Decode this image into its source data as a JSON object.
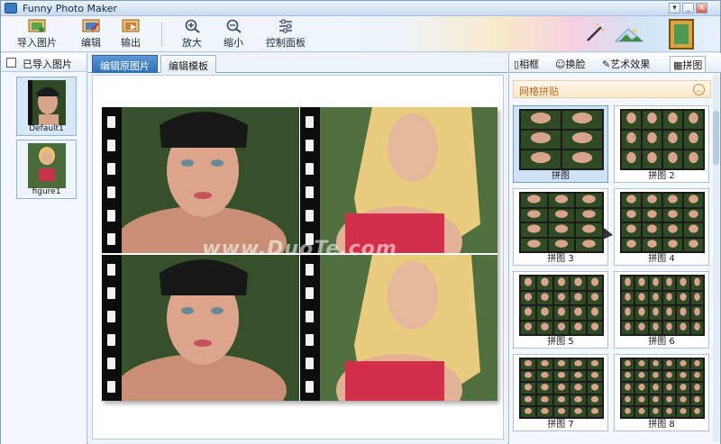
{
  "window": {
    "title": "Funny Photo Maker"
  },
  "toolbar": {
    "import_label": "导入图片",
    "edit_label": "编辑",
    "export_label": "输出",
    "zoom_in_label": "放大",
    "zoom_out_label": "缩小",
    "control_panel_label": "控制面板"
  },
  "left_panel": {
    "title": "已导入图片",
    "items": [
      {
        "label": "Default1",
        "selected": true
      },
      {
        "label": "figure1",
        "selected": false
      }
    ]
  },
  "center": {
    "tabs": [
      {
        "label": "编辑原图片",
        "active": true
      },
      {
        "label": "编辑模板",
        "active": false
      }
    ],
    "watermark": "www.DuoTe.com"
  },
  "right_panel": {
    "tabs": [
      {
        "label": "相框",
        "active": false
      },
      {
        "label": "换脸",
        "active": false
      },
      {
        "label": "艺术效果",
        "active": false
      },
      {
        "label": "拼图",
        "active": true
      }
    ],
    "section_title": "网格拼贴",
    "grid_items": [
      {
        "label": "拼图",
        "cols": 2,
        "rows": 3,
        "selected": true
      },
      {
        "label": "拼图 2",
        "cols": 4,
        "rows": 3,
        "selected": false
      },
      {
        "label": "拼图 3",
        "cols": 3,
        "rows": 4,
        "selected": false
      },
      {
        "label": "拼图 4",
        "cols": 4,
        "rows": 4,
        "selected": false
      },
      {
        "label": "拼图 5",
        "cols": 5,
        "rows": 4,
        "selected": false
      },
      {
        "label": "拼图 6",
        "cols": 6,
        "rows": 4,
        "selected": false
      },
      {
        "label": "拼图 7",
        "cols": 5,
        "rows": 5,
        "selected": false
      },
      {
        "label": "拼图 8",
        "cols": 6,
        "rows": 5,
        "selected": false
      }
    ]
  },
  "colors": {
    "accent": "#2f6fb5",
    "section_text": "#c26a1f",
    "film": "#0d0d0d"
  }
}
